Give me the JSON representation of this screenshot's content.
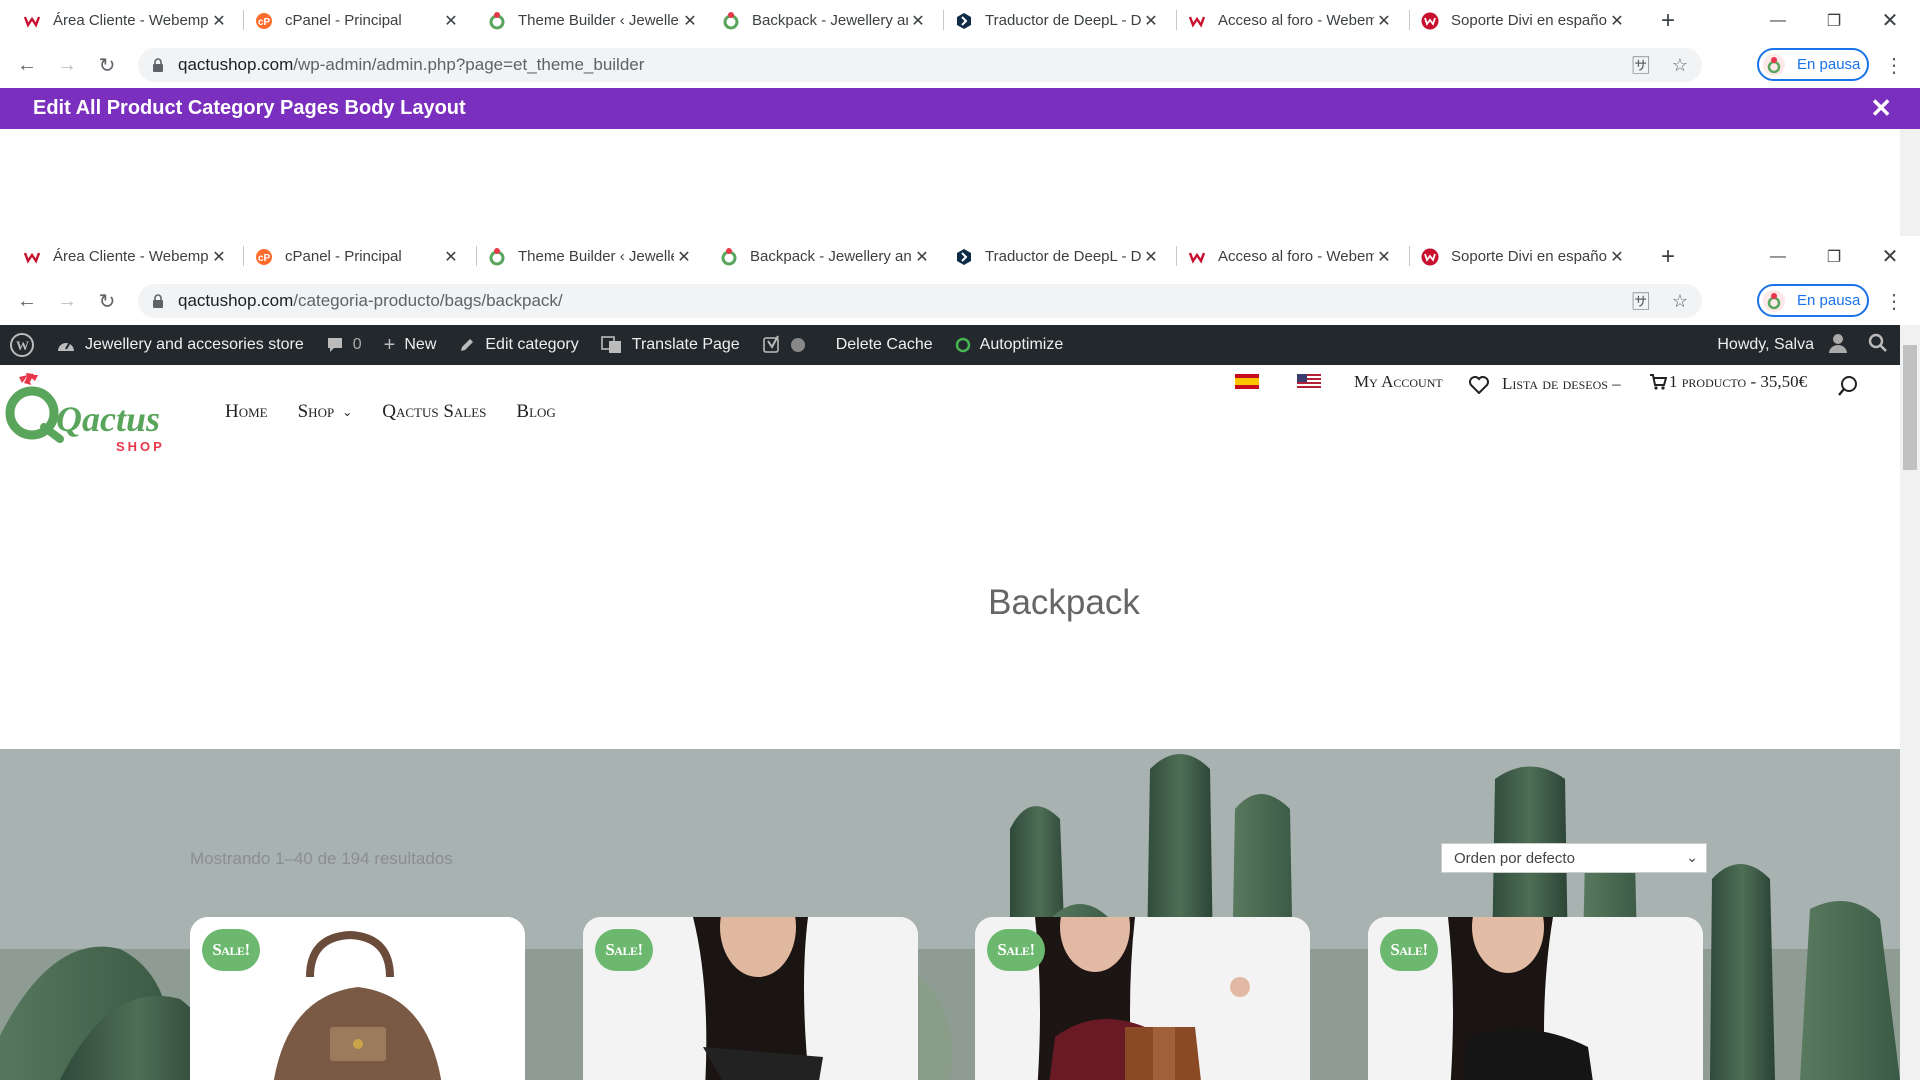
{
  "top_window": {
    "tabs": [
      {
        "title": "Área Cliente - Webempresa",
        "icon": "webempresa-icon",
        "active": false
      },
      {
        "title": "cPanel - Principal",
        "icon": "cpanel-icon",
        "active": false
      },
      {
        "title": "Theme Builder ‹ Jewellery",
        "icon": "qactus-icon",
        "active": true
      },
      {
        "title": "Backpack - Jewellery and",
        "icon": "qactus-icon",
        "active": false
      },
      {
        "title": "Traductor de DeepL - DeepL",
        "icon": "deepl-icon",
        "active": false
      },
      {
        "title": "Acceso al foro - Webempresa",
        "icon": "webempresa-icon",
        "active": false
      },
      {
        "title": "Soporte Divi en español",
        "icon": "webempresa-red-icon",
        "active": false
      }
    ],
    "url_host": "qactushop.com",
    "url_path": "/wp-admin/admin.php?page=et_theme_builder",
    "profile_label": "En pausa"
  },
  "modal": {
    "title": "Edit All Product Category Pages Body Layout",
    "close_glyph": "✕"
  },
  "inner_window": {
    "tabs": [
      {
        "title": "Área Cliente - Webempresa",
        "icon": "webempresa-icon",
        "active": false
      },
      {
        "title": "cPanel - Principal",
        "icon": "cpanel-icon",
        "active": false
      },
      {
        "title": "Theme Builder ‹ Jewellery",
        "icon": "qactus-icon",
        "active": false
      },
      {
        "title": "Backpack - Jewellery and",
        "icon": "qactus-icon",
        "active": true
      },
      {
        "title": "Traductor de DeepL - DeepL",
        "icon": "deepl-icon",
        "active": false
      },
      {
        "title": "Acceso al foro - Webempresa",
        "icon": "webempresa-icon",
        "active": false
      },
      {
        "title": "Soporte Divi en español",
        "icon": "webempresa-red-icon",
        "active": false
      }
    ],
    "url_host": "qactushop.com",
    "url_path": "/categoria-producto/bags/backpack/",
    "profile_label": "En pausa"
  },
  "admin_bar": {
    "site_name": "Jewellery and accesories store",
    "comments_count": "0",
    "new_label": "New",
    "edit_category_label": "Edit category",
    "translate_label": "Translate Page",
    "delete_cache_label": "Delete Cache",
    "autoptimize_label": "Autoptimize",
    "howdy_label": "Howdy, Salva"
  },
  "site": {
    "logo_text": "Qactus",
    "logo_sub": "SHOP",
    "nav": [
      "Home",
      "Shop",
      "Qactus Sales",
      "Blog"
    ],
    "account_label": "My Account",
    "wishlist_label": "Lista de deseos –",
    "cart_label": "1 producto - 35,50€",
    "page_title": "Backpack",
    "results_text": "Mostrando 1–40 de 194 resultados",
    "sort_selected": "Orden por defecto",
    "sale_badge": "Sale!",
    "product_count": 4
  },
  "colors": {
    "modal_bar": "#7b2fbe",
    "admin_bar": "#23282d",
    "sale_badge": "#6cb86f",
    "logo_green": "#5aa55c",
    "logo_red": "#e8374a"
  }
}
